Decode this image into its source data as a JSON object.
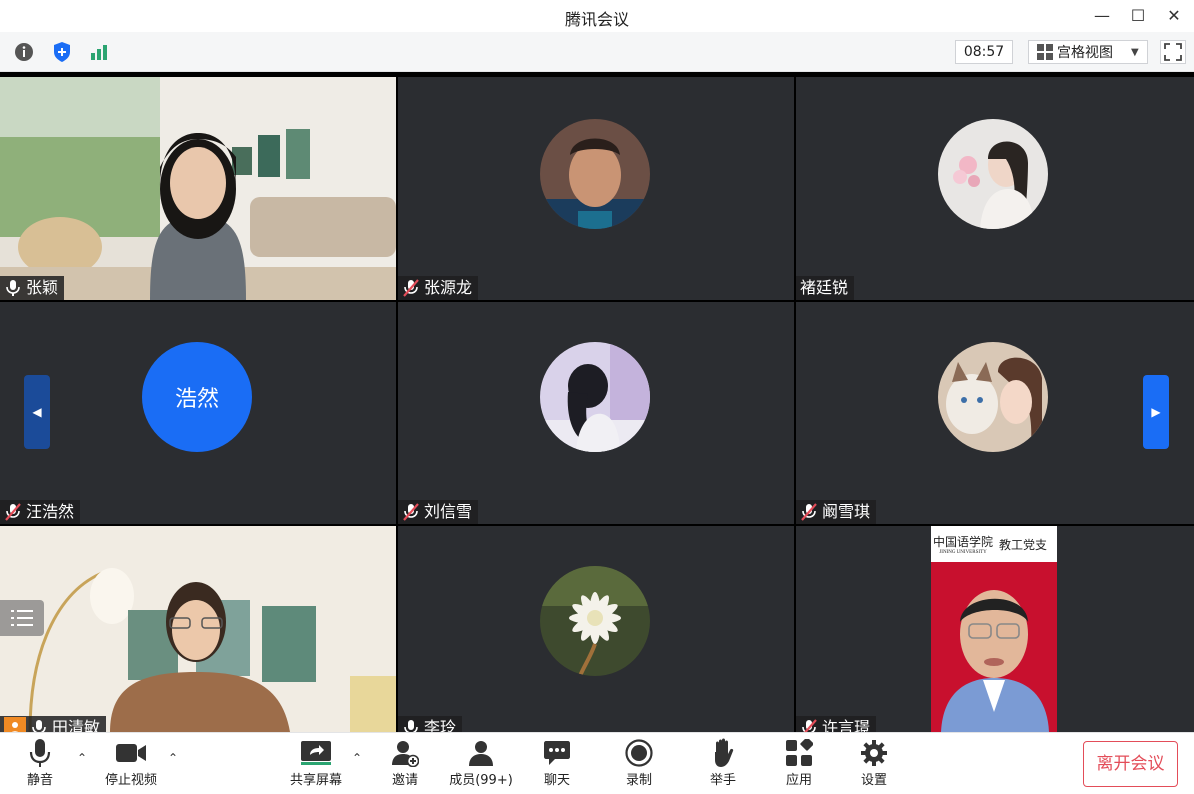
{
  "window": {
    "title": "腾讯会议"
  },
  "toolbar": {
    "time": "08:57",
    "view_label": "宫格视图"
  },
  "participants": [
    {
      "name": "张颖",
      "mic": "on",
      "type": "video"
    },
    {
      "name": "张源龙",
      "mic": "muted",
      "type": "avatar"
    },
    {
      "name": "褚廷锐",
      "mic": "none",
      "type": "avatar"
    },
    {
      "name": "汪浩然",
      "mic": "muted",
      "type": "initials",
      "initials": "浩然"
    },
    {
      "name": "刘信雪",
      "mic": "muted",
      "type": "avatar"
    },
    {
      "name": "阚雪琪",
      "mic": "muted",
      "type": "avatar"
    },
    {
      "name": "田清敏",
      "mic": "on",
      "type": "video"
    },
    {
      "name": "李玲",
      "mic": "on",
      "type": "avatar"
    },
    {
      "name": "许言璟",
      "mic": "muted",
      "type": "video",
      "banner_text_left": "中国语学院",
      "banner_sub": "JINING UNIVERSITY",
      "banner_text_right": "教工党支"
    }
  ],
  "bottombar": {
    "mute": "静音",
    "stop_video": "停止视频",
    "share": "共享屏幕",
    "invite": "邀请",
    "members": "成员(99+)",
    "chat": "聊天",
    "record": "录制",
    "raise_hand": "举手",
    "apps": "应用",
    "settings": "设置",
    "leave": "离开会议"
  },
  "colors": {
    "accent": "#1a6df5",
    "leave": "#e34d59",
    "tile_bg": "#2b2d31",
    "signal": "#2ba471"
  }
}
